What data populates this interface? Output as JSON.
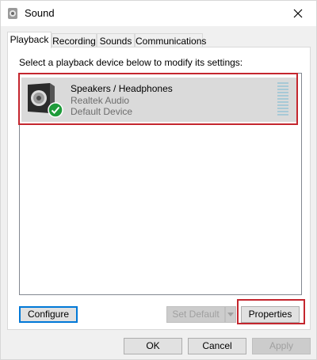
{
  "window": {
    "title": "Sound",
    "icon": "speaker-icon",
    "close_icon": "close-icon"
  },
  "tabs": [
    {
      "label": "Playback",
      "active": true
    },
    {
      "label": "Recording",
      "active": false
    },
    {
      "label": "Sounds",
      "active": false
    },
    {
      "label": "Communications",
      "active": false
    }
  ],
  "playback": {
    "instruction": "Select a playback device below to modify its settings:",
    "devices": [
      {
        "name": "Speakers / Headphones",
        "driver": "Realtek Audio",
        "status": "Default Device",
        "icon": "speaker-device-icon",
        "status_icon": "green-check-icon",
        "selected": true
      }
    ],
    "configure_label": "Configure",
    "set_default_label": "Set Default",
    "properties_label": "Properties"
  },
  "footer": {
    "ok_label": "OK",
    "cancel_label": "Cancel",
    "apply_label": "Apply"
  },
  "colors": {
    "highlight": "#c4262e",
    "check_green": "#1e9b3a",
    "selection": "#dadada"
  }
}
